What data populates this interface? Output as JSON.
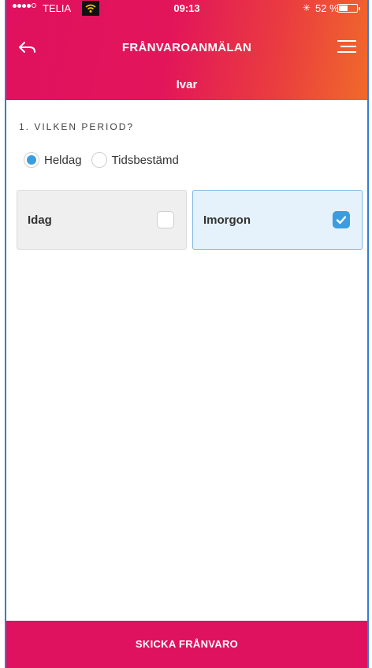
{
  "status_bar": {
    "carrier": "TELIA",
    "time": "09:13",
    "battery": "52 %",
    "battery_level": 0.52,
    "signal_icon": "signal-dots-icon",
    "wifi_icon": "wifi-icon",
    "bluetooth_icon": "bluetooth-icon"
  },
  "header": {
    "title": "FRÅNVAROANMÄLAN",
    "subtitle": "Ivar",
    "back_icon": "back-arrow-icon",
    "menu_icon": "hamburger-menu-icon"
  },
  "period": {
    "label": "1. VILKEN PERIOD?",
    "options": [
      {
        "label": "Heldag",
        "selected": true
      },
      {
        "label": "Tidsbestämd",
        "selected": false
      }
    ]
  },
  "days": [
    {
      "label": "Idag",
      "checked": false
    },
    {
      "label": "Imorgon",
      "checked": true
    }
  ],
  "footer": {
    "submit_label": "SKICKA FRÅNVARO"
  },
  "colors": {
    "accent": "#e0115f",
    "accent_orange": "#f06a2a",
    "selected_blue": "#3a9de0"
  }
}
